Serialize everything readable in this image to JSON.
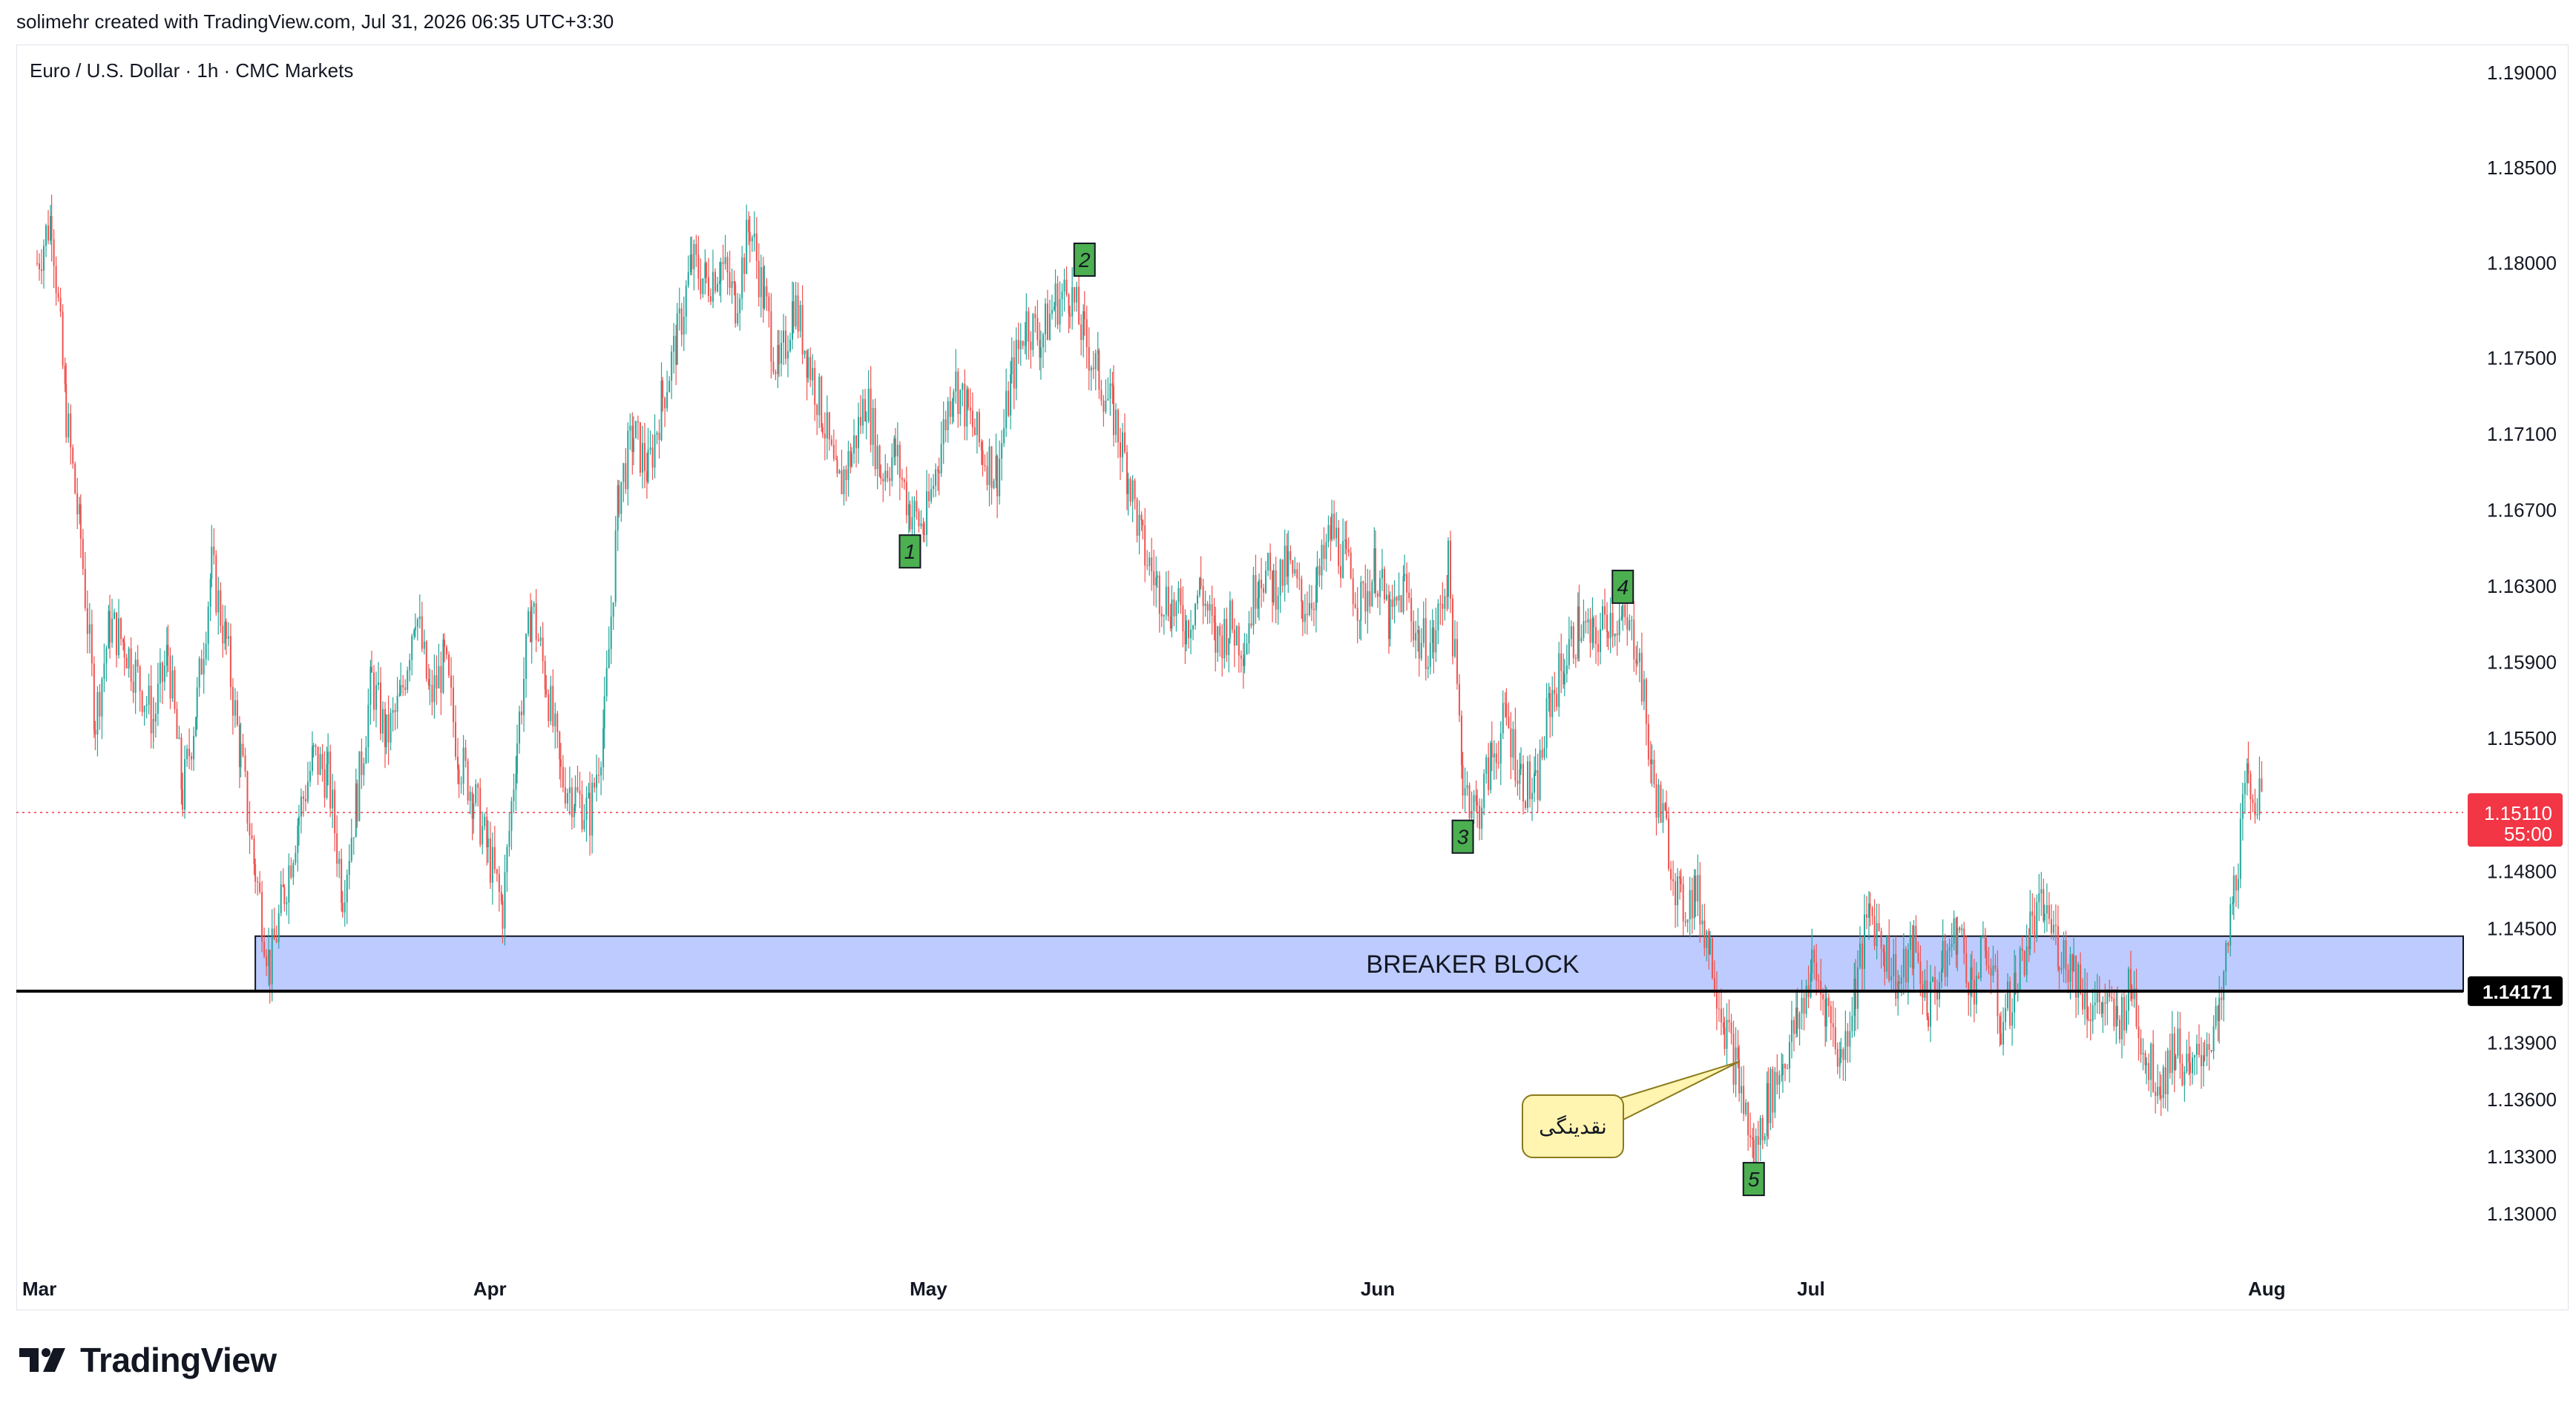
{
  "header": {
    "credit": "solimehr created with TradingView.com, Jul 31, 2026 06:35 UTC+3:30"
  },
  "symbol": {
    "title": "Euro / U.S. Dollar · 1h · CMC Markets"
  },
  "brand": {
    "name": "TradingView"
  },
  "colors": {
    "up": "#26a69a",
    "down": "#ef5350",
    "zone_fill": "#bdcbff",
    "price_badge": "#f23645",
    "level_badge": "#000000",
    "marker_fill": "#4caf50",
    "callout_fill": "#fff4b0"
  },
  "chart_data": {
    "type": "candlestick",
    "instrument": "Euro / U.S. Dollar",
    "timeframe": "1h",
    "source": "CMC Markets",
    "price_axis": {
      "ticks": [
        "1.19000",
        "1.18500",
        "1.18000",
        "1.17500",
        "1.17100",
        "1.16700",
        "1.16300",
        "1.15900",
        "1.15500",
        "1.14800",
        "1.14500",
        "1.13900",
        "1.13600",
        "1.13300",
        "1.13000"
      ]
    },
    "time_axis": {
      "ticks": [
        "Mar",
        "Apr",
        "May",
        "Jun",
        "Jul",
        "Aug"
      ]
    },
    "current_price": {
      "value": "1.15110",
      "countdown": "55:00"
    },
    "level_line": {
      "value": "1.14171"
    },
    "zone": {
      "label": "BREAKER BLOCK",
      "from": 1.1417,
      "to": 1.1446,
      "start_date": "2026-03-16"
    },
    "price_path": [
      [
        "2026-03-01",
        1.18
      ],
      [
        "2026-03-02",
        1.1825
      ],
      [
        "2026-03-03",
        1.172
      ],
      [
        "2026-03-04",
        1.1655
      ],
      [
        "2026-03-05",
        1.156
      ],
      [
        "2026-03-06",
        1.161
      ],
      [
        "2026-03-07",
        1.16
      ],
      [
        "2026-03-09",
        1.156
      ],
      [
        "2026-03-10",
        1.1595
      ],
      [
        "2026-03-11",
        1.152
      ],
      [
        "2026-03-12",
        1.157
      ],
      [
        "2026-03-13",
        1.164
      ],
      [
        "2026-03-14",
        1.16
      ],
      [
        "2026-03-15",
        1.154
      ],
      [
        "2026-03-16",
        1.148
      ],
      [
        "2026-03-17",
        1.143
      ],
      [
        "2026-03-18",
        1.147
      ],
      [
        "2026-03-19",
        1.151
      ],
      [
        "2026-03-20",
        1.154
      ],
      [
        "2026-03-21",
        1.153
      ],
      [
        "2026-03-22",
        1.147
      ],
      [
        "2026-03-23",
        1.152
      ],
      [
        "2026-03-24",
        1.158
      ],
      [
        "2026-03-25",
        1.155
      ],
      [
        "2026-03-26",
        1.157
      ],
      [
        "2026-03-27",
        1.162
      ],
      [
        "2026-03-28",
        1.157
      ],
      [
        "2026-03-29",
        1.159
      ],
      [
        "2026-03-30",
        1.154
      ],
      [
        "2026-03-31",
        1.152
      ],
      [
        "2026-04-01",
        1.149
      ],
      [
        "2026-04-02",
        1.146
      ],
      [
        "2026-04-03",
        1.155
      ],
      [
        "2026-04-04",
        1.162
      ],
      [
        "2026-04-05",
        1.158
      ],
      [
        "2026-04-06",
        1.153
      ],
      [
        "2026-04-07",
        1.152
      ],
      [
        "2026-04-08",
        1.151
      ],
      [
        "2026-04-09",
        1.156
      ],
      [
        "2026-04-10",
        1.168
      ],
      [
        "2026-04-11",
        1.171
      ],
      [
        "2026-04-12",
        1.169
      ],
      [
        "2026-04-13",
        1.173
      ],
      [
        "2026-04-14",
        1.176
      ],
      [
        "2026-04-15",
        1.18
      ],
      [
        "2026-04-16",
        1.179
      ],
      [
        "2026-04-17",
        1.18
      ],
      [
        "2026-04-18",
        1.178
      ],
      [
        "2026-04-19",
        1.182
      ],
      [
        "2026-04-20",
        1.178
      ],
      [
        "2026-04-21",
        1.174
      ],
      [
        "2026-04-22",
        1.178
      ],
      [
        "2026-04-23",
        1.175
      ],
      [
        "2026-04-24",
        1.172
      ],
      [
        "2026-04-25",
        1.168
      ],
      [
        "2026-04-26",
        1.17
      ],
      [
        "2026-04-27",
        1.173
      ],
      [
        "2026-04-28",
        1.169
      ],
      [
        "2026-04-29",
        1.17
      ],
      [
        "2026-04-30",
        1.167
      ],
      [
        "2026-05-01",
        1.166
      ],
      [
        "2026-05-02",
        1.17
      ],
      [
        "2026-05-03",
        1.174
      ],
      [
        "2026-05-04",
        1.172
      ],
      [
        "2026-05-05",
        1.17
      ],
      [
        "2026-05-06",
        1.169
      ],
      [
        "2026-05-07",
        1.174
      ],
      [
        "2026-05-08",
        1.177
      ],
      [
        "2026-05-09",
        1.176
      ],
      [
        "2026-05-10",
        1.178
      ],
      [
        "2026-05-11",
        1.1785
      ],
      [
        "2026-05-12",
        1.176
      ],
      [
        "2026-05-13",
        1.174
      ],
      [
        "2026-05-14",
        1.172
      ],
      [
        "2026-05-15",
        1.169
      ],
      [
        "2026-05-16",
        1.165
      ],
      [
        "2026-05-17",
        1.163
      ],
      [
        "2026-05-18",
        1.162
      ],
      [
        "2026-05-19",
        1.161
      ],
      [
        "2026-05-20",
        1.163
      ],
      [
        "2026-05-21",
        1.16
      ],
      [
        "2026-05-22",
        1.161
      ],
      [
        "2026-05-23",
        1.16
      ],
      [
        "2026-05-24",
        1.164
      ],
      [
        "2026-05-25",
        1.163
      ],
      [
        "2026-05-26",
        1.164
      ],
      [
        "2026-05-27",
        1.162
      ],
      [
        "2026-05-28",
        1.163
      ],
      [
        "2026-05-29",
        1.166
      ],
      [
        "2026-05-30",
        1.164
      ],
      [
        "2026-05-31",
        1.162
      ],
      [
        "2026-06-01",
        1.164
      ],
      [
        "2026-06-02",
        1.161
      ],
      [
        "2026-06-03",
        1.163
      ],
      [
        "2026-06-04",
        1.16
      ],
      [
        "2026-06-05",
        1.16
      ],
      [
        "2026-06-06",
        1.164
      ],
      [
        "2026-06-07",
        1.153
      ],
      [
        "2026-06-08",
        1.151
      ],
      [
        "2026-06-09",
        1.154
      ],
      [
        "2026-06-10",
        1.156
      ],
      [
        "2026-06-11",
        1.153
      ],
      [
        "2026-06-12",
        1.152
      ],
      [
        "2026-06-13",
        1.157
      ],
      [
        "2026-06-14",
        1.159
      ],
      [
        "2026-06-15",
        1.161
      ],
      [
        "2026-06-16",
        1.16
      ],
      [
        "2026-06-17",
        1.1615
      ],
      [
        "2026-06-18",
        1.161
      ],
      [
        "2026-06-19",
        1.16
      ],
      [
        "2026-06-20",
        1.153
      ],
      [
        "2026-06-21",
        1.15
      ],
      [
        "2026-06-22",
        1.146
      ],
      [
        "2026-06-23",
        1.147
      ],
      [
        "2026-06-24",
        1.144
      ],
      [
        "2026-06-25",
        1.14
      ],
      [
        "2026-06-26",
        1.137
      ],
      [
        "2026-06-27",
        1.133
      ],
      [
        "2026-06-28",
        1.136
      ],
      [
        "2026-06-29",
        1.138
      ],
      [
        "2026-06-30",
        1.14
      ],
      [
        "2026-07-01",
        1.143
      ],
      [
        "2026-07-02",
        1.141
      ],
      [
        "2026-07-03",
        1.138
      ],
      [
        "2026-07-04",
        1.142
      ],
      [
        "2026-07-05",
        1.146
      ],
      [
        "2026-07-06",
        1.144
      ],
      [
        "2026-07-07",
        1.142
      ],
      [
        "2026-07-08",
        1.144
      ],
      [
        "2026-07-09",
        1.141
      ],
      [
        "2026-07-10",
        1.143
      ],
      [
        "2026-07-11",
        1.145
      ],
      [
        "2026-07-12",
        1.142
      ],
      [
        "2026-07-13",
        1.144
      ],
      [
        "2026-07-14",
        1.14
      ],
      [
        "2026-07-15",
        1.142
      ],
      [
        "2026-07-16",
        1.145
      ],
      [
        "2026-07-17",
        1.146
      ],
      [
        "2026-07-18",
        1.144
      ],
      [
        "2026-07-19",
        1.143
      ],
      [
        "2026-07-20",
        1.141
      ],
      [
        "2026-07-21",
        1.141
      ],
      [
        "2026-07-22",
        1.14
      ],
      [
        "2026-07-23",
        1.142
      ],
      [
        "2026-07-24",
        1.138
      ],
      [
        "2026-07-25",
        1.137
      ],
      [
        "2026-07-26",
        1.139
      ],
      [
        "2026-07-27",
        1.137
      ],
      [
        "2026-07-28",
        1.139
      ],
      [
        "2026-07-29",
        1.14
      ],
      [
        "2026-07-30",
        1.147
      ],
      [
        "2026-07-31",
        1.153
      ],
      [
        "2026-08-01",
        1.1511
      ]
    ],
    "markers": [
      {
        "label": "1",
        "date": "2026-04-30",
        "price": 1.166
      },
      {
        "label": "2",
        "date": "2026-05-12",
        "price": 1.179
      },
      {
        "label": "3",
        "date": "2026-06-07",
        "price": 1.151
      },
      {
        "label": "4",
        "date": "2026-06-18",
        "price": 1.1618
      },
      {
        "label": "5",
        "date": "2026-06-27",
        "price": 1.133
      }
    ],
    "callout": {
      "text": "نقدینگی",
      "date": "2026-06-26",
      "price": 1.138
    }
  }
}
